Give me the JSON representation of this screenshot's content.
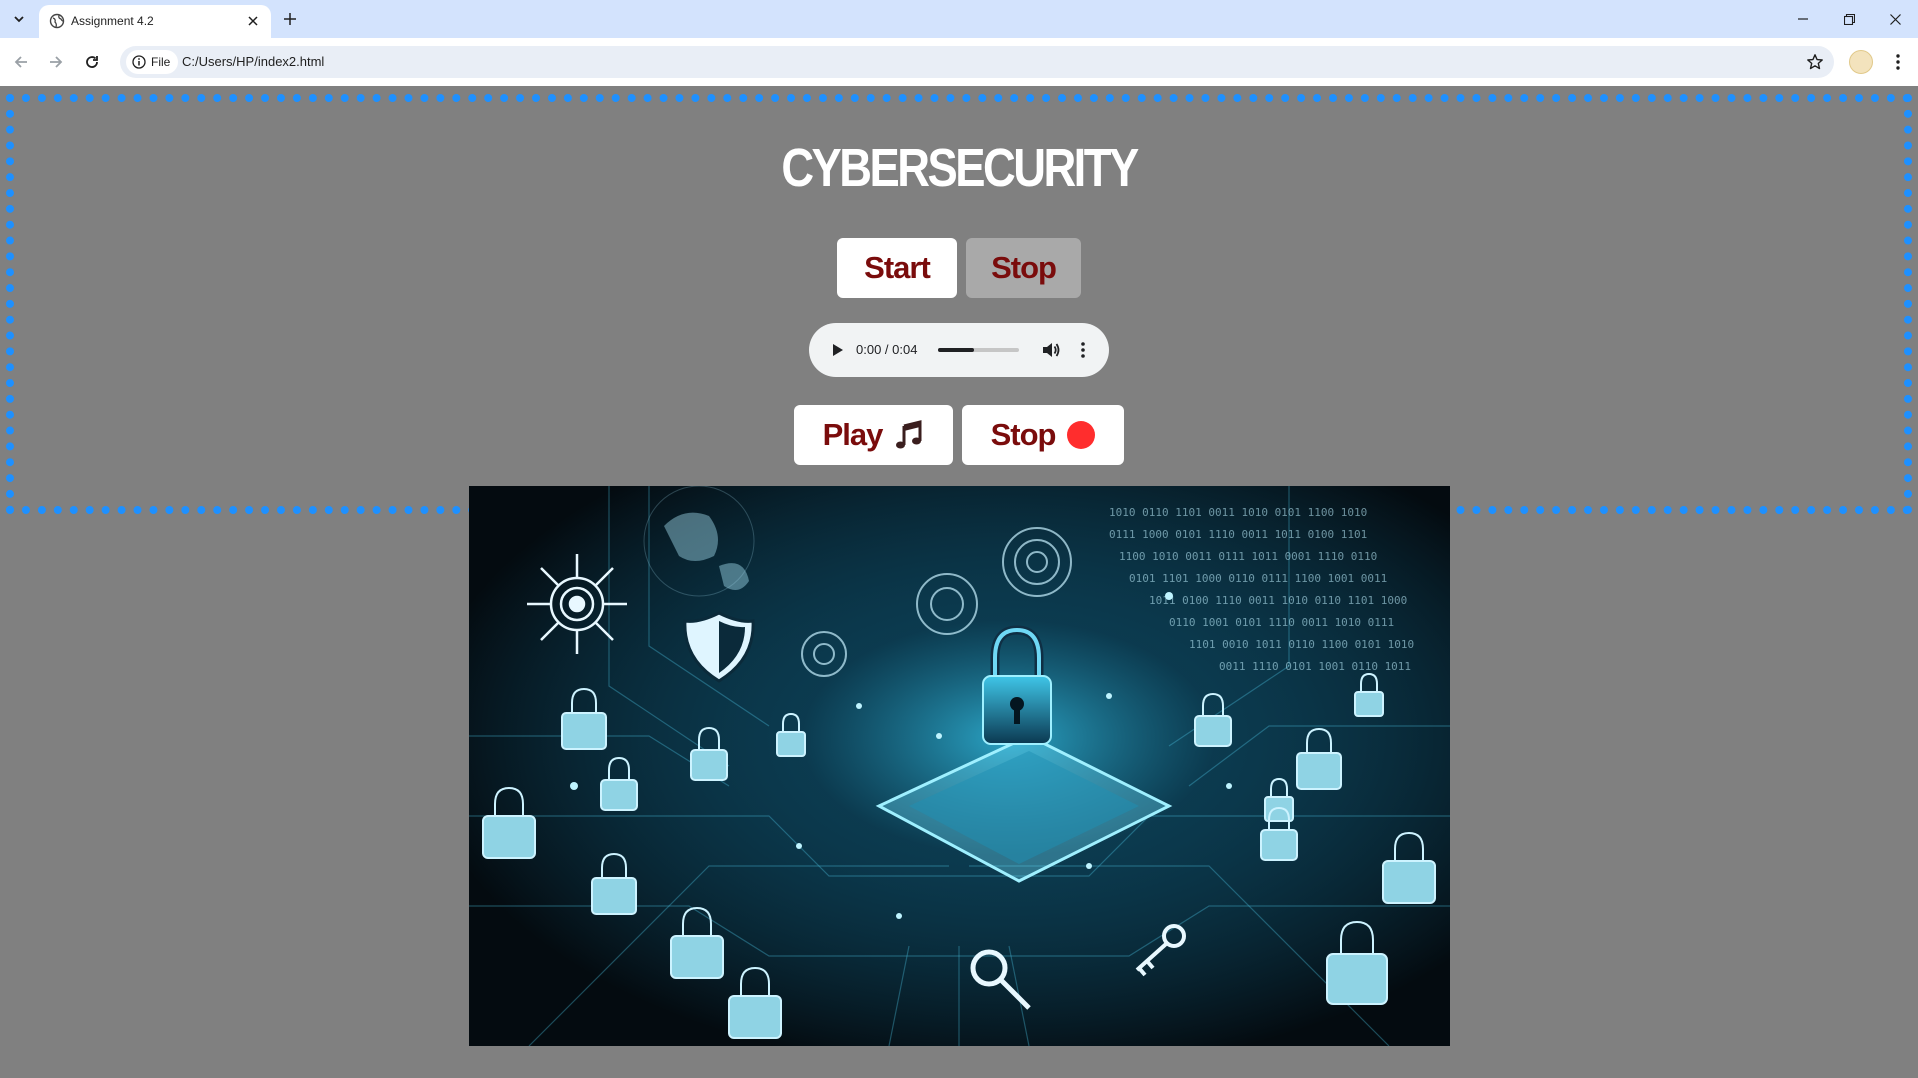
{
  "browser": {
    "tab_title": "Assignment 4.2",
    "site_chip": "File",
    "url": "C:/Users/HP/index2.html"
  },
  "page": {
    "title": "CYBERSECURITY",
    "start_label": "Start",
    "stop_label": "Stop",
    "audio": {
      "time": "0:00 / 0:04",
      "progress_fraction": 0.44
    },
    "play_label": "Play",
    "stop2_label": "Stop",
    "colors": {
      "background": "#808080",
      "border": "#1e90ff",
      "button_text": "#7a0c0c",
      "stop_disabled_bg": "#a9a9a9",
      "stop_dot": "#ff2d2d"
    },
    "hero_image": {
      "kind": "cybersecurity illustration",
      "icons": [
        "padlock-icon",
        "shield-icon",
        "key-icon",
        "globe-icon",
        "binary-code"
      ]
    }
  }
}
